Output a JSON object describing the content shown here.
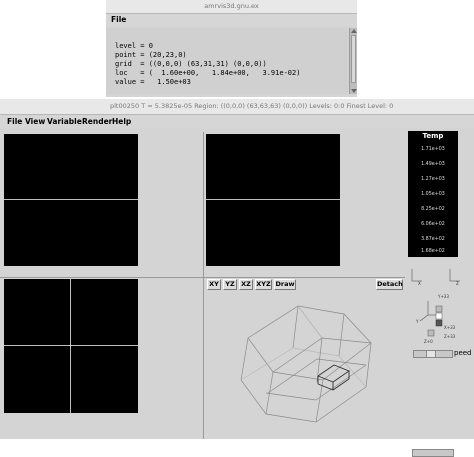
{
  "info_window": {
    "title": "amrvis3d.gnu.ex",
    "menu_file": "File",
    "lines": [
      "level = 0",
      "point = (20,23,0)",
      "grid  = ((0,0,0) (63,31,31) (0,0,0))",
      "loc   = (  1.60e+00,   1.84e+00,   3.91e-02)",
      "value =   1.50e+03"
    ]
  },
  "main_window": {
    "title": "plt00250   T = 5.3825e-05   Region: ((0,0,0) (63,63,63) (0,0,0))   Levels: 0:0   Finest Level: 0",
    "menus": [
      "File",
      "View",
      "Variable",
      "Render",
      "Help"
    ],
    "toolbar": {
      "xy": "XY",
      "yz": "YZ",
      "xz": "XZ",
      "xyz": "XYZ",
      "draw": "Draw",
      "detach": "Detach"
    },
    "palette": {
      "title": "Temp",
      "labels": [
        "1.71e+03",
        "1.49e+03",
        "1.27e+03",
        "1.05e+03",
        "8.25e+02",
        "6.06e+02",
        "3.87e+02",
        "1.68e+02"
      ]
    },
    "orient": {
      "x_plus": "X+33",
      "y_plus": "Y+33",
      "z_plus": "Z+33",
      "z_minus": "Z+0",
      "axis_x": "X",
      "axis_y": "Y",
      "axis_z": "Z"
    },
    "speed_label": "peed"
  },
  "colors": {
    "panel_bg": "#d4d4d4",
    "view_bg": "#000000",
    "wire": "#8a8a8a"
  }
}
